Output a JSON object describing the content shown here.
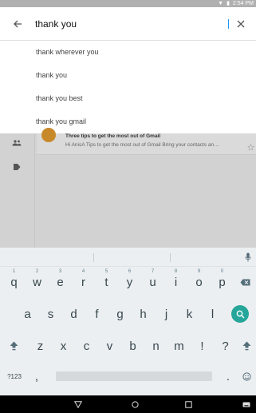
{
  "status": {
    "time": "2:54 PM",
    "icons": [
      "wifi-icon",
      "battery-icon"
    ]
  },
  "search": {
    "query": "thank you",
    "back": "arrow-left-icon",
    "clear": "close-icon"
  },
  "suggestions": [
    "thank wherever you",
    "thank you",
    "thank you best",
    "thank you gmail"
  ],
  "email": {
    "subject": "Three tips to get the most out of Gmail",
    "snippet": "Hi AnisA Tips to get the most out of Gmail Bring your contacts an…"
  },
  "keyboard": {
    "row1": [
      {
        "k": "q",
        "h": "1"
      },
      {
        "k": "w",
        "h": "2"
      },
      {
        "k": "e",
        "h": "3"
      },
      {
        "k": "r",
        "h": "4"
      },
      {
        "k": "t",
        "h": "5"
      },
      {
        "k": "y",
        "h": "6"
      },
      {
        "k": "u",
        "h": "7"
      },
      {
        "k": "i",
        "h": "8"
      },
      {
        "k": "o",
        "h": "9"
      },
      {
        "k": "p",
        "h": "0"
      }
    ],
    "row2": [
      "a",
      "s",
      "d",
      "f",
      "g",
      "h",
      "j",
      "k",
      "l"
    ],
    "row3": [
      "z",
      "x",
      "c",
      "v",
      "b",
      "n",
      "m",
      "!",
      "?"
    ],
    "symbols_label": "?123",
    "comma": ",",
    "period": "."
  },
  "colors": {
    "accent": "#26a69a",
    "caret": "#2196f3",
    "avatar": "#c8892a"
  }
}
